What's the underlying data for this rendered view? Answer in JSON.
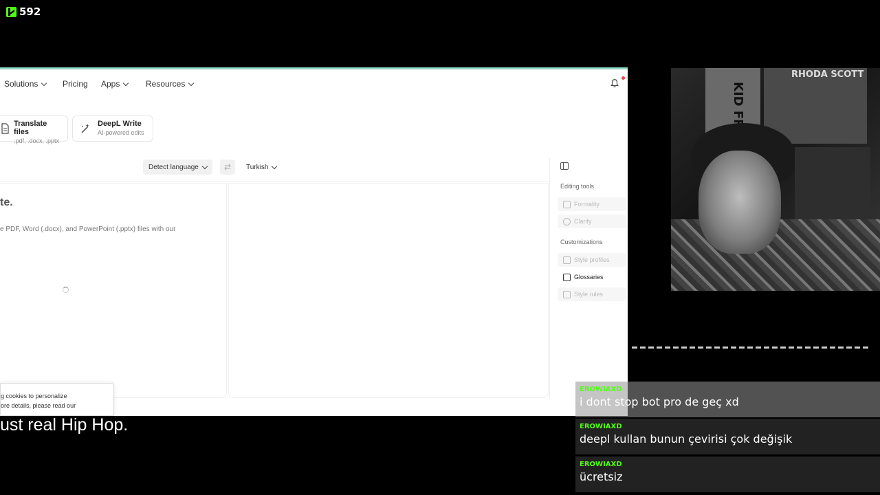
{
  "stream": {
    "viewer_count": "592",
    "subtitle": "ust real Hip Hop."
  },
  "nav": {
    "items": [
      {
        "label": "Solutions"
      },
      {
        "label": "Pricing"
      },
      {
        "label": "Apps"
      },
      {
        "label": "Resources"
      }
    ]
  },
  "cards": [
    {
      "title": "Translate files",
      "subtitle": ".pdf, .docx, .pptx"
    },
    {
      "title": "DeepL Write",
      "subtitle": "AI-powered edits"
    }
  ],
  "translator": {
    "source_lang": "Detect language",
    "target_lang": "Turkish",
    "heading": "te.",
    "body": "e PDF, Word (.docx), and PowerPoint (.pptx) files with our"
  },
  "sidebar": {
    "editing_heading": "Editing tools",
    "editing_items": [
      {
        "label": "Formality"
      },
      {
        "label": "Clarify"
      }
    ],
    "custom_heading": "Customizations",
    "custom_items": [
      {
        "label": "Style profiles"
      },
      {
        "label": "Glossaries"
      },
      {
        "label": "Style rules"
      }
    ]
  },
  "cookie": {
    "line1": "g cookies to personalize",
    "line2": "ore details, please read our"
  },
  "webcam": {
    "poster_text_1": "RHODA SCOTT",
    "poster_text_2": "KID FROST"
  },
  "chat": [
    {
      "user": "EROWIAXD",
      "text": "i dont stop bot pro de geç xd"
    },
    {
      "user": "EROWIAXD",
      "text": "deepl kullan bunun çevirisi çok değişik"
    },
    {
      "user": "EROWIAXD",
      "text": "ücretsiz"
    }
  ],
  "colors": {
    "kick_green": "#53fc18",
    "accent_line": "#8fd9c4",
    "notification_dot": "#e5484d"
  }
}
